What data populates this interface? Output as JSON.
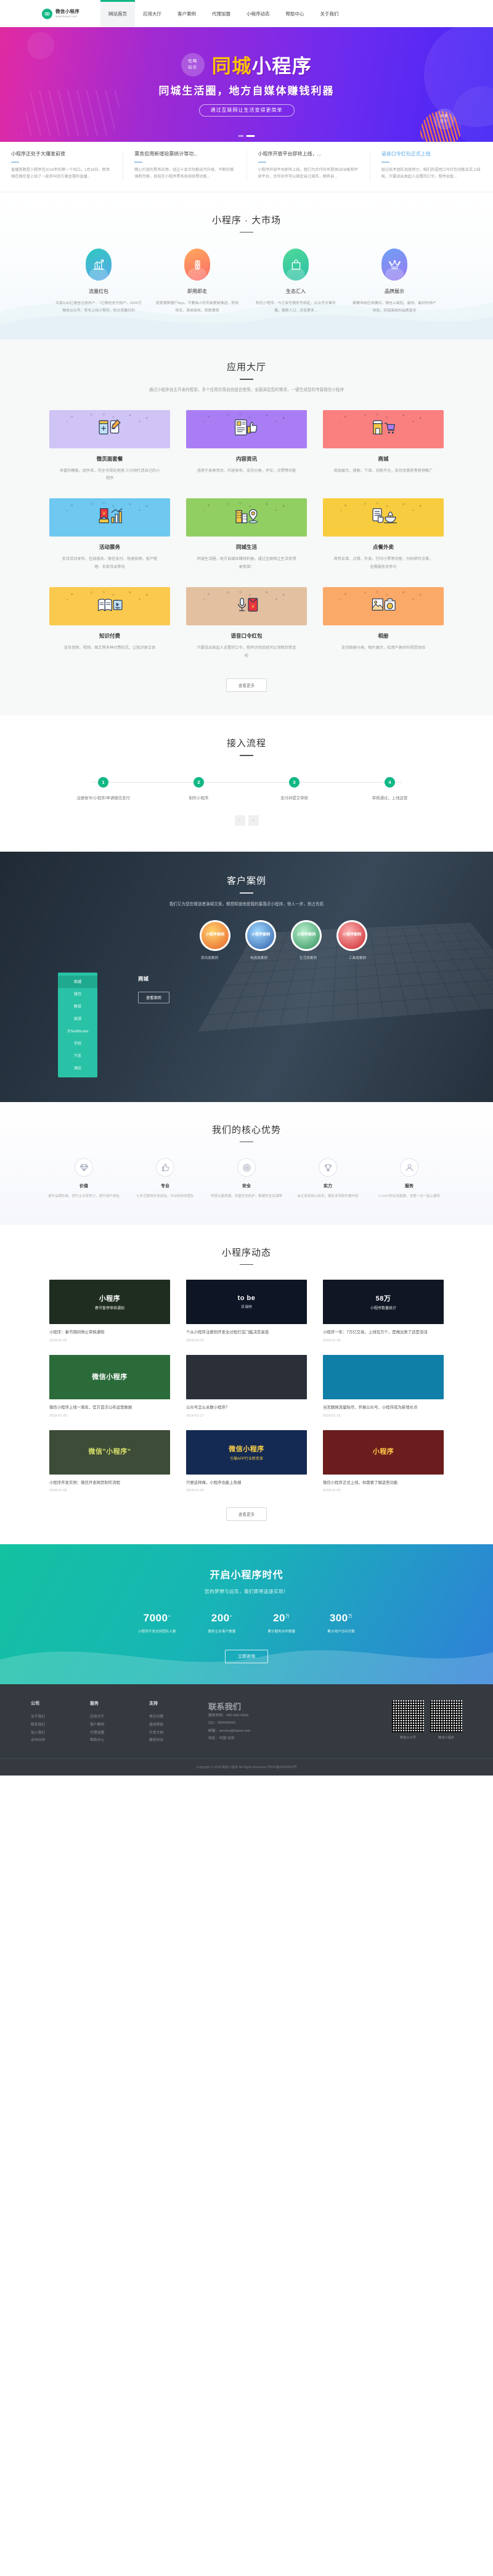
{
  "header": {
    "logo_title": "微信小程序",
    "logo_sub": "www.baiud.com",
    "nav": [
      {
        "label": "网站首页",
        "active": true
      },
      {
        "label": "应用大厅",
        "active": false
      },
      {
        "label": "客户案例",
        "active": false
      },
      {
        "label": "代理加盟",
        "active": false
      },
      {
        "label": "小程序动态",
        "active": false
      },
      {
        "label": "帮助中心",
        "active": false
      },
      {
        "label": "关于我们",
        "active": false
      }
    ]
  },
  "hero": {
    "badge_line1": "吃喝",
    "badge_line2": "玩乐",
    "title_yellow": "同城",
    "title_white": "小程序",
    "subtitle": "同城生活圈，地方自媒体赚钱利器",
    "pill": "通过互联网让生活变得更简单",
    "badge2_line1": "衣食",
    "badge2_line2": "住行"
  },
  "news_strip": [
    {
      "title": "小程序正处于大爆发前夜",
      "desc": "直播答题是小程序在2018年的第一个风口。1月18日，新世相在微信里上线了一款名叫百万黄金屋的直播...",
      "highlight": false
    },
    {
      "title": "票务应用新增验票统计等功...",
      "desc": "精心打造的票务应用，经过十余次功能迭代升级，不断的增强和完善，目前在小程序票务系统验票功能...",
      "highlight": false
    },
    {
      "title": "小程序开放平台即将上线，...",
      "desc": "小程序开放平台即将上线，我们为合作伙伴提供OEM版和平放平台，合作伙伴可以绑定自己域名，拥有自...",
      "highlight": false
    },
    {
      "title": "语音口令红包正式上线",
      "desc": "经过技术团队加班努力，咱们的语音口令红包功能正式上线啦，只要说出发起人设置的口令，程序会智...",
      "highlight": true
    }
  ],
  "market": {
    "title": "小程序 · 大市场",
    "items": [
      {
        "icon": "chart-up-icon",
        "name": "流量红包",
        "desc": "共享9.85亿微信注册用户，7亿微信支付用户，2000万微信公众号，率先上线小程序，抢占流量红利"
      },
      {
        "icon": "clover-icon",
        "name": "即用即走",
        "desc": "拒绝满屏僵尸App，不要恼人的安装更新推送，即用即走，简单高效，就是潇洒"
      },
      {
        "icon": "shopping-bag-icon",
        "name": "生态汇入",
        "desc": "附近小程序，与订阅号服务号绑定，公众号文章传播，搜索入口，还有更多..."
      },
      {
        "icon": "crown-icon",
        "name": "品牌展示",
        "desc": "颠覆传统应用模式，微信上最轻、最快、最好的用户体验，实现高效的品牌宣传"
      }
    ]
  },
  "app_hall": {
    "title": "应用大厅",
    "subtitle": "通过小程序自主开发的框架，多个应用实现自由组合使用，全面满足您的需求，一键生成您的专属微信小程序",
    "more_label": "查看更多",
    "cards": [
      {
        "name": "微页面套餐",
        "desc": "丰富的模板、组件库，完全可视化拖拽 三分钟打造自己的小程序",
        "color": "#cfc4f5",
        "icon": "page-edit-icon"
      },
      {
        "name": "内容资讯",
        "desc": "适用于各类资讯、内容发布，支持分类、评论、点赞等功能",
        "color": "#a97ef5",
        "icon": "news-thumb-icon"
      },
      {
        "name": "商城",
        "desc": "商品展示，搜索，下单，功能齐全，支持优惠券等营销推广",
        "color": "#fa8080",
        "icon": "shop-cart-icon"
      },
      {
        "name": "活动票务",
        "desc": "支持活动发布、在线报名、微信支付、快速核销、客户管理、名单导出等功",
        "color": "#6ec8f0",
        "icon": "ticket-chart-icon"
      },
      {
        "name": "同城生活",
        "desc": "同城生活圈，地方自媒体赚钱利器，通过互联网让生活变得更简单！",
        "color": "#92cf63",
        "icon": "city-pin-icon"
      },
      {
        "name": "点餐外卖",
        "desc": "具有买单、点餐、外卖、打印小票等功能，扫码即可点餐，无需服务员参与",
        "color": "#f7cc3f",
        "icon": "order-rice-icon"
      },
      {
        "name": "知识付费",
        "desc": "支持音频、视频、图文等多种付费形式，让知识更立体",
        "color": "#fbc94e",
        "icon": "book-play-icon"
      },
      {
        "name": "语音口令红包",
        "desc": "只要说出发起人设置的口令，程序识别后就可以领取到赏金啦",
        "color": "#e2c0a0",
        "icon": "mic-redpacket-icon"
      },
      {
        "name": "相册",
        "desc": "支持相册分类，相片展示，给用户更好的视觉体验",
        "color": "#fba968",
        "icon": "photo-camera-icon"
      }
    ]
  },
  "process": {
    "title": "接入流程",
    "steps": [
      {
        "num": "1",
        "label": "注册帐号/小程序/申请微信支付"
      },
      {
        "num": "2",
        "label": "制作小程序"
      },
      {
        "num": "3",
        "label": "支付并提交审核"
      },
      {
        "num": "4",
        "label": "审核通过，上线运营"
      }
    ],
    "prev_icon": "chevron-left-icon",
    "next_icon": "chevron-right-icon"
  },
  "cases": {
    "title": "客户案例",
    "subtitle": "我们又为您在赠送者演绎文案，都想知道他是我的最靠近小程序，快人一步，抢占先机",
    "circles": [
      {
        "label": "小程序案例",
        "name": "资讯类案例"
      },
      {
        "label": "小程序案例",
        "name": "电商类案例"
      },
      {
        "label": "小程序案例",
        "name": "生活类案例"
      },
      {
        "label": "小程序案例",
        "name": "工具类案例"
      }
    ],
    "menu": [
      {
        "label": "商城",
        "active": true
      },
      {
        "label": "餐饮",
        "active": false
      },
      {
        "label": "教育",
        "active": false
      },
      {
        "label": "旅游",
        "active": false
      },
      {
        "label": "大healthcare",
        "active": false
      },
      {
        "label": "学校",
        "active": false
      },
      {
        "label": "汽车",
        "active": false
      },
      {
        "label": "酒店",
        "active": false
      }
    ],
    "detail_title": "商城",
    "detail_btn": "查看案例"
  },
  "advantage": {
    "title": "我们的核心优势",
    "items": [
      {
        "icon": "diamond-icon",
        "name": "价值",
        "desc": "提升品牌形象，提升企业竞争力，提升用户体验"
      },
      {
        "icon": "thumb-up-icon",
        "name": "专业",
        "desc": "七年互联网开发经验，专业的技术团队"
      },
      {
        "icon": "target-icon",
        "name": "安全",
        "desc": "阿里云服务器，多重安全防护，数据安全有保障"
      },
      {
        "icon": "trophy-icon",
        "name": "实力",
        "desc": "自主研发核心技术，拥有多项软件著作权"
      },
      {
        "icon": "service-icon",
        "name": "服务",
        "desc": "7×24小时在线客服，全程一对一贴心服务"
      }
    ]
  },
  "dynamics": {
    "title": "小程序动态",
    "more_label": "查看更多",
    "cards": [
      {
        "title": "小程序：春节期间停止审核通知",
        "date": "2018-02-05",
        "thumb_text": "小程序",
        "thumb_sub": "春节暂停审核通知",
        "bg": "#1f2d20",
        "fg": "#ffffff"
      },
      {
        "title": "个从小程序注册到开发全过程打造门槛决定高低",
        "date": "2018-02-02",
        "thumb_text": "to be",
        "thumb_sub": "正当时",
        "bg": "#0e1525",
        "fg": "#ffffff"
      },
      {
        "title": "小程序一年：7万亿交易，上线包万个，是做出来了还是泡沫",
        "date": "2018-01-30",
        "thumb_text": "58万",
        "thumb_sub": "小程序数量统计",
        "bg": "#101624",
        "fg": "#ffffff"
      },
      {
        "title": "微信小程序上线一周年，官方首次公布运营数据",
        "date": "2018-01-20",
        "thumb_text": "微信小程序",
        "thumb_sub": "",
        "bg": "#2b6b3a",
        "fg": "#ffffff"
      },
      {
        "title": "公众号怎么关联小程序？",
        "date": "2018-01-17",
        "thumb_text": "",
        "thumb_sub": "",
        "bg": "#2a2f38",
        "fg": "#ffffff"
      },
      {
        "title": "当互联网流量殆尽，开展公众号、小程序成为新增长点",
        "date": "2018-01-15",
        "thumb_text": "",
        "thumb_sub": "",
        "bg": "#0f7fa8",
        "fg": "#ffffff"
      },
      {
        "title": "小程序开发实例：微信开发网页制作流程",
        "date": "2018-01-09",
        "thumb_text": "微信\"小程序\"",
        "thumb_sub": "",
        "bg": "#3d4c37",
        "fg": "#d8e06a"
      },
      {
        "title": "只要这样做，小程序也能上热搜",
        "date": "2018-01-05",
        "thumb_text": "微信小程序",
        "thumb_sub": "引爆APP行业新变革",
        "bg": "#142a52",
        "fg": "#ffd24a"
      },
      {
        "title": "微信小程序正式上线，你需要了解这些功能",
        "date": "2018-01-03",
        "thumb_text": "小程序",
        "thumb_sub": "",
        "bg": "#6b1d1d",
        "fg": "#ffc94a"
      }
    ]
  },
  "cta": {
    "title": "开启小程序时代",
    "subtitle": "您的梦想与远见，我们即将追逐实现！",
    "stats": [
      {
        "num": "7000",
        "sup": "+",
        "label": "小程序开发支持团队人数"
      },
      {
        "num": "200",
        "sup": "+",
        "label": "服务企业客户数量"
      },
      {
        "num": "20",
        "sup": "万",
        "label": "累计服务合作数量"
      },
      {
        "num": "300",
        "sup": "万",
        "label": "累计用户访问次数"
      }
    ],
    "btn": "立即咨询"
  },
  "footer": {
    "columns": [
      {
        "title": "公司",
        "links": [
          "关于我们",
          "联系我们",
          "加入我们",
          "合作伙伴"
        ]
      },
      {
        "title": "服务",
        "links": [
          "应用大厅",
          "客户案例",
          "代理加盟",
          "帮助中心"
        ]
      },
      {
        "title": "支持",
        "links": [
          "常见问题",
          "使用帮助",
          "开发文档",
          "服务协议"
        ]
      }
    ],
    "contact_title": "联系我们",
    "contact_lines": [
      "服务热线：400-000-0000",
      "QQ：000000000",
      "邮箱：service@baiud.com",
      "地址：中国·深圳"
    ],
    "qr": [
      {
        "label": "微信公众号"
      },
      {
        "label": "微信小程序"
      }
    ],
    "copyright": "Copyright © 2018 微信小程序 All Rights Reserved  粤ICP备00000000号"
  }
}
